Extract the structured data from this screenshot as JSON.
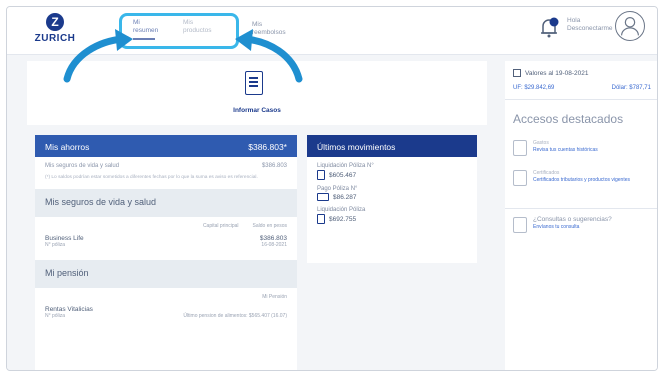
{
  "header": {
    "logo_text": "ZURICH",
    "tabs": [
      {
        "label": "Mi\nresumen"
      },
      {
        "label": "Mis\nproductos"
      },
      {
        "label": "Mis\nreembolsos"
      }
    ],
    "greeting_line1": "Hola",
    "greeting_line2": "Desconectarme"
  },
  "main": {
    "informar_label": "Informar Casos",
    "ahorros": {
      "title": "Mis ahorros",
      "total": "$386.803*",
      "row_label": "Mis seguros de vida y salud",
      "row_value": "$386.803",
      "note": "(*) Lo saldos podrían estar sometidos a diferentes fechas por lo que la suma es aviso es referencial."
    },
    "seguros": {
      "title": "Mis seguros de vida y salud",
      "col1": "Capital principal",
      "col2": "Saldo en pesos",
      "product": "Business Life",
      "poliza": "N° póliza",
      "value": "$386.803",
      "date": "16-08-2021"
    },
    "pension": {
      "title": "Mi pensión",
      "col": "Mi Pensión",
      "product": "Rentas Vitalicias",
      "poliza": "N° póliza",
      "detail": "Último pension de alimentos: $565.407 (16.07)"
    },
    "movimientos": {
      "title": "Últimos movimientos",
      "items": [
        {
          "title": "Liquidación Póliza N°",
          "amount": "$605.467"
        },
        {
          "title": "Pago Póliza N°",
          "amount": "$86.287"
        },
        {
          "title": "Liquidación Póliza",
          "amount": "$692.755"
        }
      ]
    }
  },
  "right": {
    "valores_title": "Valores al 19-08-2021",
    "uf": "UF: $29.842,69",
    "dolar": "Dólar: $787,71",
    "accesos_title": "Accesos destacados",
    "items": [
      {
        "title": "Gastos",
        "link": "Revisa tus cuentas históricas"
      },
      {
        "title": "Certificados",
        "link": "Certificados tributarios y productos vigentes"
      }
    ],
    "consultas_title": "¿Consultas o sugerencias?",
    "consultas_link": "Envíanos tu consulta"
  },
  "colors": {
    "brand": "#1b3a8c",
    "highlight": "#3ab7ea"
  }
}
